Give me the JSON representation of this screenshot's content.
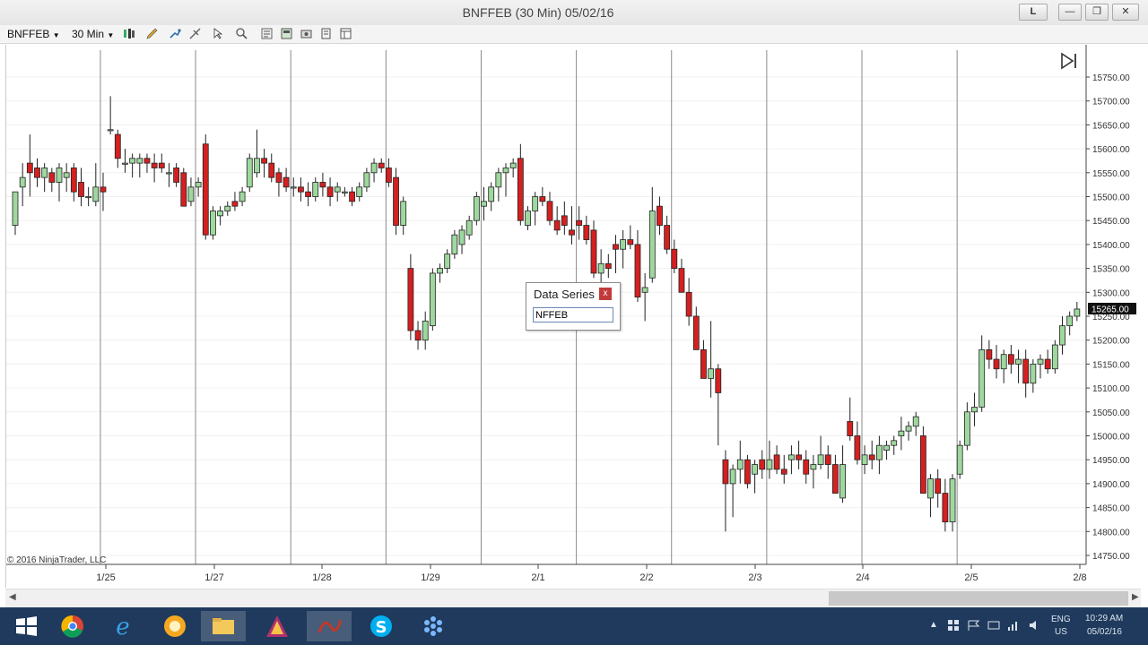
{
  "window": {
    "title": "BNFFEB (30 Min)  05/02/16",
    "buttons": [
      "L",
      "—",
      "❐",
      "✕"
    ]
  },
  "toolbar": {
    "instrument": "BNFFEB",
    "interval": "30 Min"
  },
  "chart_data": {
    "type": "candlestick",
    "title": "BNFFEB (30 Min)",
    "ylim": [
      14750,
      15750
    ],
    "y_ticks": [
      15750,
      15700,
      15650,
      15600,
      15550,
      15500,
      15450,
      15400,
      15350,
      15300,
      15250,
      15200,
      15150,
      15100,
      15050,
      15000,
      14950,
      14900,
      14850,
      14800,
      14750
    ],
    "y_tick_labels": [
      "15750.00",
      "15700.00",
      "15650.00",
      "15600.00",
      "15550.00",
      "15500.00",
      "15450.00",
      "15400.00",
      "15350.00",
      "15300.00",
      "15250.00",
      "15200.00",
      "15150.00",
      "15100.00",
      "15050.00",
      "15000.00",
      "14950.00",
      "14900.00",
      "14850.00",
      "14800.00",
      "14750.00"
    ],
    "x_labels": [
      "1/25",
      "1/27",
      "1/28",
      "1/29",
      "2/1",
      "2/2",
      "2/3",
      "2/4",
      "2/5",
      "2/8"
    ],
    "last_price": "15265.00",
    "up_color": "#9fd89f",
    "down_color": "#d42020",
    "candles": [
      [
        15440,
        15510,
        15420,
        15510
      ],
      [
        15520,
        15570,
        15480,
        15540
      ],
      [
        15570,
        15630,
        15500,
        15550
      ],
      [
        15560,
        15580,
        15520,
        15540
      ],
      [
        15540,
        15570,
        15510,
        15560
      ],
      [
        15550,
        15560,
        15510,
        15530
      ],
      [
        15530,
        15570,
        15490,
        15560
      ],
      [
        15540,
        15570,
        15510,
        15550
      ],
      [
        15560,
        15570,
        15490,
        15510
      ],
      [
        15530,
        15560,
        15480,
        15500
      ],
      [
        15500,
        15520,
        15480,
        15500
      ],
      [
        15490,
        15570,
        15480,
        15520
      ],
      [
        15520,
        15550,
        15470,
        15510
      ],
      [
        15640,
        15710,
        15630,
        15640
      ],
      [
        15630,
        15640,
        15560,
        15580
      ],
      [
        15570,
        15600,
        15550,
        15570
      ],
      [
        15570,
        15590,
        15540,
        15580
      ],
      [
        15570,
        15590,
        15540,
        15580
      ],
      [
        15580,
        15590,
        15550,
        15570
      ],
      [
        15570,
        15590,
        15530,
        15560
      ],
      [
        15570,
        15590,
        15550,
        15560
      ],
      [
        15550,
        15570,
        15520,
        15550
      ],
      [
        15560,
        15570,
        15520,
        15530
      ],
      [
        15550,
        15560,
        15480,
        15480
      ],
      [
        15490,
        15540,
        15480,
        15520
      ],
      [
        15520,
        15540,
        15500,
        15530
      ],
      [
        15610,
        15630,
        15410,
        15420
      ],
      [
        15420,
        15480,
        15410,
        15470
      ],
      [
        15460,
        15480,
        15440,
        15470
      ],
      [
        15470,
        15490,
        15460,
        15480
      ],
      [
        15490,
        15510,
        15470,
        15480
      ],
      [
        15490,
        15520,
        15480,
        15510
      ],
      [
        15520,
        15590,
        15510,
        15580
      ],
      [
        15550,
        15640,
        15540,
        15580
      ],
      [
        15580,
        15600,
        15540,
        15570
      ],
      [
        15570,
        15590,
        15530,
        15540
      ],
      [
        15550,
        15560,
        15500,
        15530
      ],
      [
        15540,
        15560,
        15510,
        15520
      ],
      [
        15520,
        15540,
        15500,
        15520
      ],
      [
        15520,
        15540,
        15490,
        15510
      ],
      [
        15510,
        15530,
        15480,
        15500
      ],
      [
        15500,
        15540,
        15490,
        15530
      ],
      [
        15530,
        15550,
        15500,
        15520
      ],
      [
        15520,
        15540,
        15480,
        15500
      ],
      [
        15510,
        15530,
        15490,
        15520
      ],
      [
        15510,
        15520,
        15500,
        15510
      ],
      [
        15510,
        15520,
        15480,
        15490
      ],
      [
        15500,
        15530,
        15490,
        15520
      ],
      [
        15520,
        15560,
        15510,
        15550
      ],
      [
        15550,
        15580,
        15530,
        15570
      ],
      [
        15570,
        15580,
        15550,
        15560
      ],
      [
        15560,
        15580,
        15520,
        15530
      ],
      [
        15540,
        15560,
        15420,
        15440
      ],
      [
        15440,
        15500,
        15420,
        15490
      ],
      [
        15350,
        15380,
        15200,
        15220
      ],
      [
        15220,
        15240,
        15180,
        15200
      ],
      [
        15200,
        15260,
        15180,
        15240
      ],
      [
        15230,
        15350,
        15220,
        15340
      ],
      [
        15340,
        15360,
        15320,
        15350
      ],
      [
        15350,
        15390,
        15340,
        15380
      ],
      [
        15380,
        15430,
        15370,
        15420
      ],
      [
        15400,
        15440,
        15380,
        15430
      ],
      [
        15420,
        15460,
        15410,
        15450
      ],
      [
        15450,
        15510,
        15440,
        15500
      ],
      [
        15480,
        15520,
        15450,
        15490
      ],
      [
        15490,
        15530,
        15470,
        15520
      ],
      [
        15520,
        15560,
        15490,
        15550
      ],
      [
        15550,
        15570,
        15500,
        15560
      ],
      [
        15560,
        15580,
        15540,
        15570
      ],
      [
        15580,
        15610,
        15440,
        15450
      ],
      [
        15440,
        15480,
        15430,
        15470
      ],
      [
        15470,
        15510,
        15440,
        15500
      ],
      [
        15500,
        15520,
        15480,
        15490
      ],
      [
        15490,
        15510,
        15440,
        15450
      ],
      [
        15450,
        15480,
        15420,
        15430
      ],
      [
        15460,
        15490,
        15420,
        15440
      ],
      [
        15430,
        15480,
        15400,
        15420
      ],
      [
        15450,
        15480,
        15410,
        15440
      ],
      [
        15440,
        15460,
        15400,
        15410
      ],
      [
        15430,
        15450,
        15330,
        15340
      ],
      [
        15340,
        15390,
        15320,
        15360
      ],
      [
        15360,
        15380,
        15330,
        15350
      ],
      [
        15400,
        15420,
        15340,
        15390
      ],
      [
        15390,
        15430,
        15350,
        15410
      ],
      [
        15410,
        15440,
        15390,
        15400
      ],
      [
        15400,
        15430,
        15280,
        15290
      ],
      [
        15300,
        15340,
        15240,
        15310
      ],
      [
        15330,
        15520,
        15320,
        15470
      ],
      [
        15480,
        15500,
        15420,
        15440
      ],
      [
        15440,
        15460,
        15380,
        15390
      ],
      [
        15390,
        15410,
        15340,
        15350
      ],
      [
        15350,
        15370,
        15300,
        15300
      ],
      [
        15300,
        15330,
        15230,
        15250
      ],
      [
        15250,
        15270,
        15180,
        15180
      ],
      [
        15180,
        15200,
        15120,
        15120
      ],
      [
        15120,
        15240,
        15080,
        15140
      ],
      [
        15140,
        15150,
        14980,
        15090
      ],
      [
        14950,
        14970,
        14800,
        14900
      ],
      [
        14900,
        14940,
        14830,
        14930
      ],
      [
        14930,
        14990,
        14900,
        14950
      ],
      [
        14950,
        14960,
        14890,
        14900
      ],
      [
        14920,
        14950,
        14880,
        14940
      ],
      [
        14950,
        14970,
        14910,
        14930
      ],
      [
        14930,
        14990,
        14910,
        14950
      ],
      [
        14960,
        14980,
        14920,
        14930
      ],
      [
        14930,
        14960,
        14900,
        14920
      ],
      [
        14950,
        14980,
        14920,
        14960
      ],
      [
        14960,
        14990,
        14930,
        14950
      ],
      [
        14950,
        14970,
        14900,
        14920
      ],
      [
        14930,
        14960,
        14890,
        14940
      ],
      [
        14940,
        15000,
        14930,
        14960
      ],
      [
        14960,
        14980,
        14910,
        14940
      ],
      [
        14940,
        14960,
        14880,
        14880
      ],
      [
        14870,
        14980,
        14860,
        14940
      ],
      [
        15030,
        15080,
        14990,
        15000
      ],
      [
        15000,
        15030,
        14940,
        14950
      ],
      [
        14940,
        14980,
        14920,
        14960
      ],
      [
        14960,
        14990,
        14930,
        14950
      ],
      [
        14950,
        15000,
        14920,
        14980
      ],
      [
        14970,
        14990,
        14950,
        14980
      ],
      [
        14980,
        15000,
        14960,
        14990
      ],
      [
        15000,
        15040,
        14970,
        15010
      ],
      [
        15010,
        15030,
        14990,
        15020
      ],
      [
        15020,
        15050,
        15000,
        15040
      ],
      [
        15000,
        15020,
        14880,
        14880
      ],
      [
        14870,
        14920,
        14830,
        14910
      ],
      [
        14910,
        14930,
        14850,
        14880
      ],
      [
        14880,
        14910,
        14800,
        14820
      ],
      [
        14820,
        14920,
        14800,
        14910
      ],
      [
        14920,
        14990,
        14910,
        14980
      ],
      [
        14980,
        15070,
        14970,
        15050
      ],
      [
        15050,
        15090,
        15020,
        15060
      ],
      [
        15060,
        15210,
        15050,
        15180
      ],
      [
        15180,
        15200,
        15140,
        15160
      ],
      [
        15160,
        15190,
        15120,
        15140
      ],
      [
        15140,
        15180,
        15110,
        15170
      ],
      [
        15170,
        15190,
        15130,
        15150
      ],
      [
        15150,
        15180,
        15110,
        15160
      ],
      [
        15160,
        15180,
        15080,
        15110
      ],
      [
        15110,
        15160,
        15090,
        15150
      ],
      [
        15150,
        15170,
        15120,
        15160
      ],
      [
        15160,
        15180,
        15130,
        15140
      ],
      [
        15140,
        15200,
        15130,
        15190
      ],
      [
        15190,
        15250,
        15170,
        15230
      ],
      [
        15230,
        15260,
        15210,
        15250
      ],
      [
        15250,
        15280,
        15240,
        15265
      ]
    ]
  },
  "copyright": "© 2016 NinjaTrader, LLC",
  "data_series_box": {
    "title": "Data Series",
    "close": "x",
    "value": "NFFEB"
  },
  "tray": {
    "lang": "ENG",
    "region": "US",
    "time": "10:29 AM",
    "date": "05/02/16"
  }
}
